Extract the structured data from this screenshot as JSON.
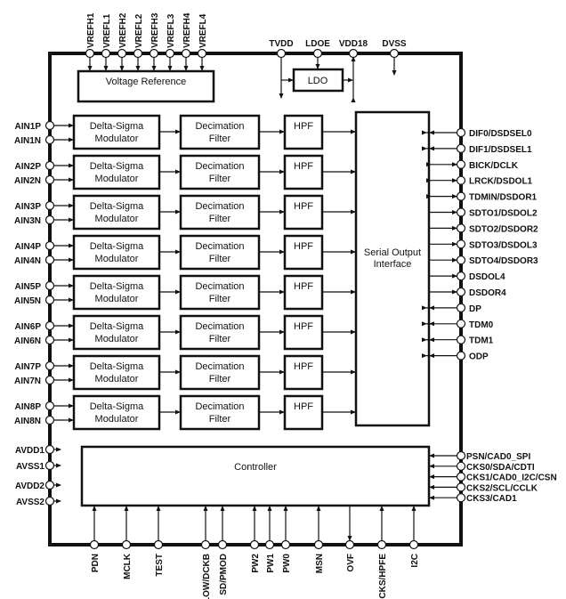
{
  "top_pins": [
    "VREFH1",
    "VREFL1",
    "VREFH2",
    "VREFL2",
    "VREFH3",
    "VREFL3",
    "VREFH4",
    "VREFL4"
  ],
  "power_pins": [
    "TVDD",
    "LDOE",
    "VDD18",
    "DVSS"
  ],
  "blocks": {
    "voltage_reference": "Voltage Reference",
    "ldo": "LDO",
    "modulator": [
      "Delta-Sigma",
      "Modulator"
    ],
    "decimation": [
      "Decimation",
      "Filter"
    ],
    "hpf": "HPF",
    "serial_output": [
      "Serial Output",
      "Interface"
    ],
    "controller": "Controller"
  },
  "channels": [
    {
      "p": "AIN1P",
      "n": "AIN1N"
    },
    {
      "p": "AIN2P",
      "n": "AIN2N"
    },
    {
      "p": "AIN3P",
      "n": "AIN3N"
    },
    {
      "p": "AIN4P",
      "n": "AIN4N"
    },
    {
      "p": "AIN5P",
      "n": "AIN5N"
    },
    {
      "p": "AIN6P",
      "n": "AIN6N"
    },
    {
      "p": "AIN7P",
      "n": "AIN7N"
    },
    {
      "p": "AIN8P",
      "n": "AIN8N"
    }
  ],
  "right_pins": [
    {
      "label": "DIF0/DSDSEL0",
      "dir": "in"
    },
    {
      "label": "DIF1/DSDSEL1",
      "dir": "in"
    },
    {
      "label": "BICK/DCLK",
      "dir": "bi"
    },
    {
      "label": "LRCK/DSDOL1",
      "dir": "bi"
    },
    {
      "label": "TDMIN/DSDOR1",
      "dir": "bi"
    },
    {
      "label": "SDTO1/DSDOL2",
      "dir": "out"
    },
    {
      "label": "SDTO2/DSDOR2",
      "dir": "out"
    },
    {
      "label": "SDTO3/DSDOL3",
      "dir": "out"
    },
    {
      "label": "SDTO4/DSDOR3",
      "dir": "out"
    },
    {
      "label": "DSDOL4",
      "dir": "out"
    },
    {
      "label": "DSDOR4",
      "dir": "out"
    },
    {
      "label": "DP",
      "dir": "in"
    },
    {
      "label": "TDM0",
      "dir": "in"
    },
    {
      "label": "TDM1",
      "dir": "in"
    },
    {
      "label": "ODP",
      "dir": "in"
    }
  ],
  "controller_right_pins": [
    "PSN/CAD0_SPI",
    "CKS0/SDA/CDTI",
    "CKS1/CAD0_I2C/CSN",
    "CKS2/SCL/CCLK",
    "CKS3/CAD1"
  ],
  "supply_pins": [
    "AVDD1",
    "AVSS1",
    "AVDD2",
    "AVSS2"
  ],
  "bottom_pins": [
    {
      "label": "PDN",
      "dir": "in"
    },
    {
      "label": "MCLK",
      "dir": "in"
    },
    {
      "label": "TEST",
      "dir": "in"
    },
    {
      "label": "SLOW/DCKB",
      "dir": "in"
    },
    {
      "label": "SD/PMOD",
      "dir": "in"
    },
    {
      "label": "PW2",
      "dir": "in"
    },
    {
      "label": "PW1",
      "dir": "in"
    },
    {
      "label": "PW0",
      "dir": "in"
    },
    {
      "label": "MSN",
      "dir": "in"
    },
    {
      "label": "OVF",
      "dir": "out"
    },
    {
      "label": "DCKS/HPFE",
      "dir": "in"
    },
    {
      "label": "I2C",
      "dir": "in"
    }
  ]
}
